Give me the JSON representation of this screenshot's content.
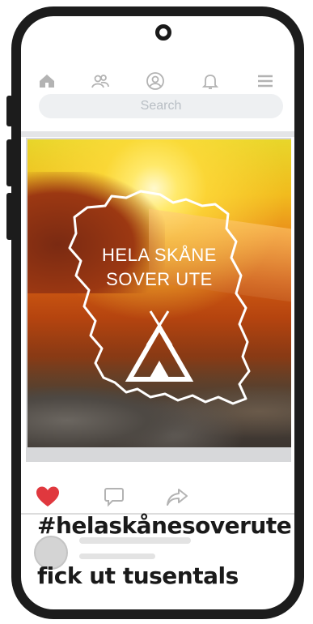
{
  "nav": {
    "icons": [
      "home-icon",
      "friends-icon",
      "profile-icon",
      "bell-icon",
      "menu-icon"
    ]
  },
  "search": {
    "placeholder": "Search"
  },
  "post": {
    "image_text_line1": "HELA SKÅNE",
    "image_text_line2": "SOVER UTE",
    "liked": true
  },
  "actions": {
    "like_icon": "heart-icon",
    "comment_icon": "comment-icon",
    "share_icon": "share-icon"
  },
  "caption": {
    "line1": "#helaskånesoverute",
    "line2": "fick ut tusentals"
  },
  "colors": {
    "phone_frame": "#1c1c1c",
    "like_red": "#e0383e",
    "nav_icon_gray": "#b3b3b3"
  }
}
